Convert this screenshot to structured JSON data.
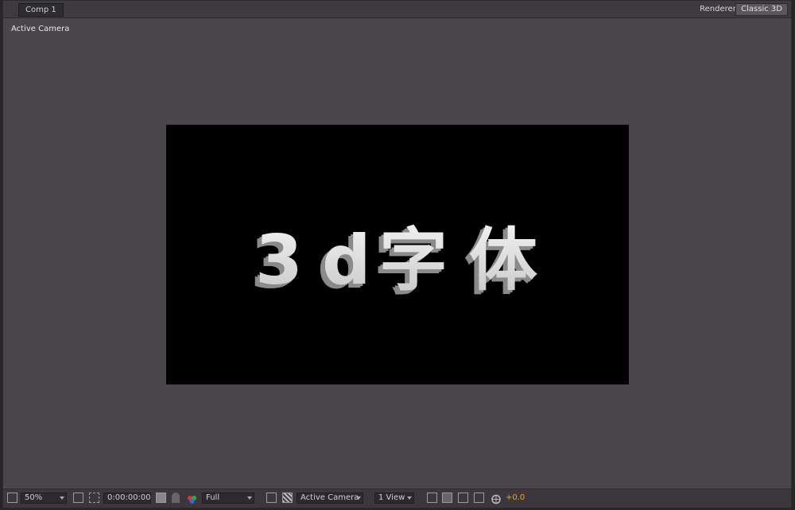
{
  "comp_tab": {
    "label": "Comp 1"
  },
  "renderer": {
    "label": "Renderer:",
    "value": "Classic 3D"
  },
  "view_label": "Active Camera",
  "composition": {
    "text": "3d字体",
    "background": "#000000"
  },
  "footer": {
    "magnification": "50%",
    "timecode": "0:00:00:00",
    "resolution": "Full",
    "camera": "Active Camera",
    "view_layout": "1 View",
    "exposure": "+0.0"
  },
  "colors": {
    "panel": "#4a454b",
    "exposure": "#e8a927"
  }
}
